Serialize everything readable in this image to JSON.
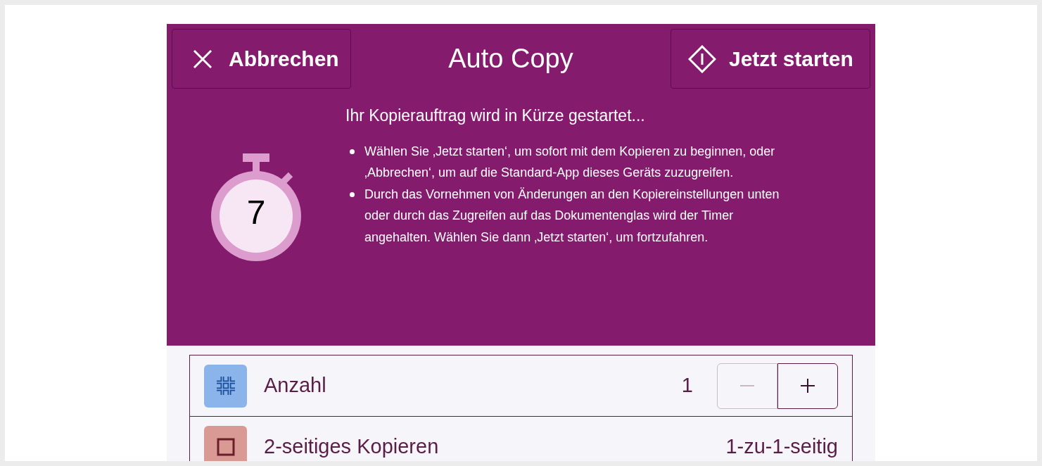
{
  "header": {
    "cancel_button": "Abbrechen",
    "title": "Auto Copy",
    "start_button": "Jetzt starten"
  },
  "countdown": {
    "value": "7"
  },
  "message": {
    "heading": "Ihr Kopierauftrag wird in Kürze gestartet...",
    "bullets": [
      "Wählen Sie ‚Jetzt starten‘, um sofort mit dem Kopieren zu beginnen, oder ‚Abbrechen‘, um auf die Standard-App dieses Geräts zuzugreifen.",
      "Durch das Vornehmen von Änderungen an den Kopiereinstellungen unten oder durch das Zugreifen auf das Dokumentenglas wird der Timer angehalten. Wählen Sie dann ‚Jetzt starten‘, um fortzufahren."
    ]
  },
  "settings": [
    {
      "kind": "stepper",
      "label": "Anzahl",
      "value": "1",
      "decrement_disabled": true,
      "increment_disabled": false
    },
    {
      "kind": "value",
      "label": "2-seitiges Kopieren",
      "value": "1-zu-1-seitig"
    }
  ]
}
